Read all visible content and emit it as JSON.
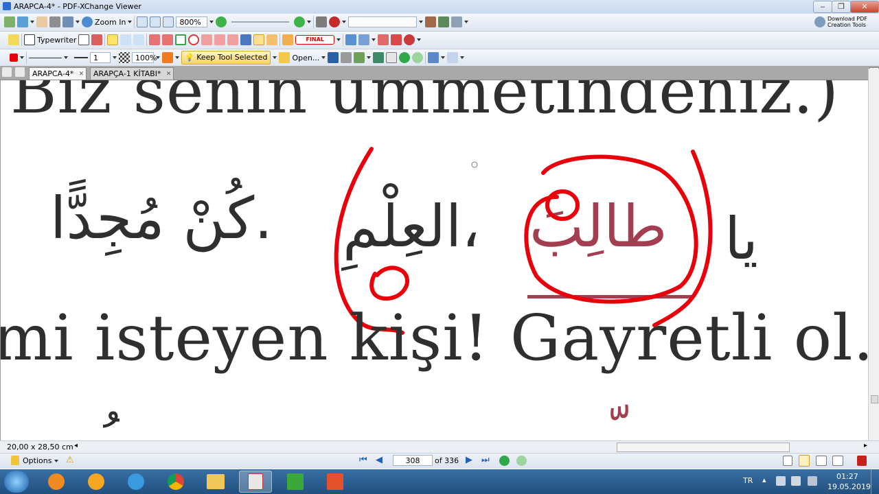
{
  "window": {
    "title": "ARAPCA-4* - PDF-XChange Viewer",
    "controls": [
      "‒",
      "❐",
      "✕"
    ]
  },
  "toolbar1": {
    "zoom_in_label": "Zoom In",
    "zoom_value": "800%",
    "download_promo_line1": "Download PDF",
    "download_promo_line2": "Creation Tools"
  },
  "toolbar2": {
    "typewriter_label": "Typewriter",
    "stamp_label": "FINAL"
  },
  "toolbar3": {
    "line_width": "1",
    "opacity": "100%",
    "keep_tool_label": "Keep Tool Selected",
    "open_label": "Open..."
  },
  "tabs": [
    {
      "label": "ARAPCA-4*",
      "active": true
    },
    {
      "label": "ARAPÇA-1 KİTABI*",
      "active": false
    }
  ],
  "document": {
    "line1": "Biz senin ümmetindeniz.)",
    "arabic_word1": "يا",
    "arabic_word2": "طالِبَ",
    "arabic_word3": "العِلْمِ،",
    "arabic_word4": "كُنْ مُجِدًّا.",
    "line3": "mi isteyen kişi! Gayretli ol.)",
    "annotation_color": "#e8000a"
  },
  "statusbar": {
    "page_size": "20,00 x 28,50 cm",
    "options_label": "Options",
    "current_page": "308",
    "total_pages": "of 336"
  },
  "taskbar": {
    "language": "TR",
    "time": "01:27",
    "date": "19.05.2019"
  }
}
